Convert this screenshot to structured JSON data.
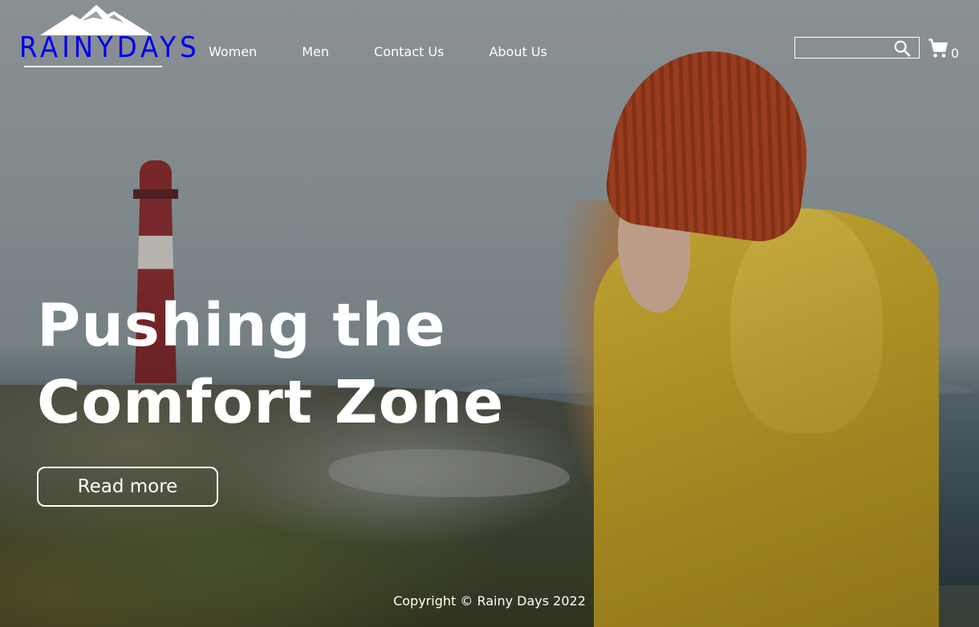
{
  "header": {
    "logo_text": "RAINYDAYS",
    "nav": [
      {
        "label": "Women"
      },
      {
        "label": "Men"
      },
      {
        "label": "Contact Us"
      },
      {
        "label": "About Us"
      }
    ],
    "search": {
      "value": "",
      "placeholder": ""
    },
    "cart": {
      "count": "0"
    }
  },
  "hero": {
    "headline_line1": "Pushing the",
    "headline_line2": "Comfort Zone",
    "cta_label": "Read more"
  },
  "footer": {
    "copyright": "Copyright © Rainy Days 2022"
  },
  "colors": {
    "text": "#ffffff",
    "coat": "#e2bd38",
    "beanie": "#b5451f"
  },
  "icons": [
    "mountain-logo-icon",
    "search-icon",
    "cart-icon"
  ]
}
